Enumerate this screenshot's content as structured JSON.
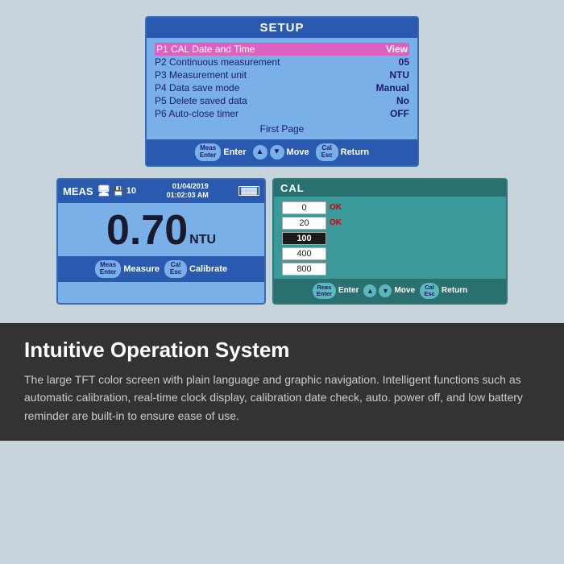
{
  "setup": {
    "title": "SETUP",
    "rows": [
      {
        "label": "P1 CAL Date and Time",
        "value": "View",
        "highlight": true
      },
      {
        "label": "P2 Continuous measurement",
        "value": "05",
        "highlight": false
      },
      {
        "label": "P3 Measurement unit",
        "value": "NTU",
        "highlight": false
      },
      {
        "label": "P4 Data save mode",
        "value": "Manual",
        "highlight": false
      },
      {
        "label": "P5 Delete saved data",
        "value": "No",
        "highlight": false
      },
      {
        "label": "P6 Auto-close timer",
        "value": "OFF",
        "highlight": false
      }
    ],
    "page_label": "First Page",
    "buttons": {
      "enter_label": "Enter",
      "move_label": "Move",
      "return_label": "Return",
      "meas_enter": "Meas\nEnter",
      "cal_esc": "Cal\nEsc",
      "up_arrow": "▲",
      "down_arrow": "▼"
    }
  },
  "meas": {
    "title": "MEAS",
    "date": "01/04/2019",
    "time": "01:02:03 AM",
    "saved_count": "10",
    "value": "0.70",
    "unit": "NTU",
    "buttons": {
      "measure_label": "Measure",
      "calibrate_label": "Calibrate",
      "meas_enter": "Meas\nEnter",
      "cal_esc": "Cal\nEsc"
    }
  },
  "cal": {
    "title": "CAL",
    "values": [
      {
        "value": "0",
        "ok": true,
        "selected": false
      },
      {
        "value": "20",
        "ok": true,
        "selected": false
      },
      {
        "value": "100",
        "ok": false,
        "selected": true
      },
      {
        "value": "400",
        "ok": false,
        "selected": false
      },
      {
        "value": "800",
        "ok": false,
        "selected": false
      }
    ],
    "buttons": {
      "enter_label": "Enter",
      "move_label": "Move",
      "return_label": "Return",
      "meas_enter": "Reas\nEnter",
      "cal_esc": "Cal\nEsc",
      "up_arrow": "▲",
      "down_arrow": "▼"
    }
  },
  "bottom": {
    "title": "Intuitive Operation System",
    "text": "The large TFT color screen with plain language and graphic navigation. Intelligent functions such as automatic calibration, real-time clock display, calibration date check, auto. power off, and low battery reminder are built-in to ensure ease of use."
  }
}
